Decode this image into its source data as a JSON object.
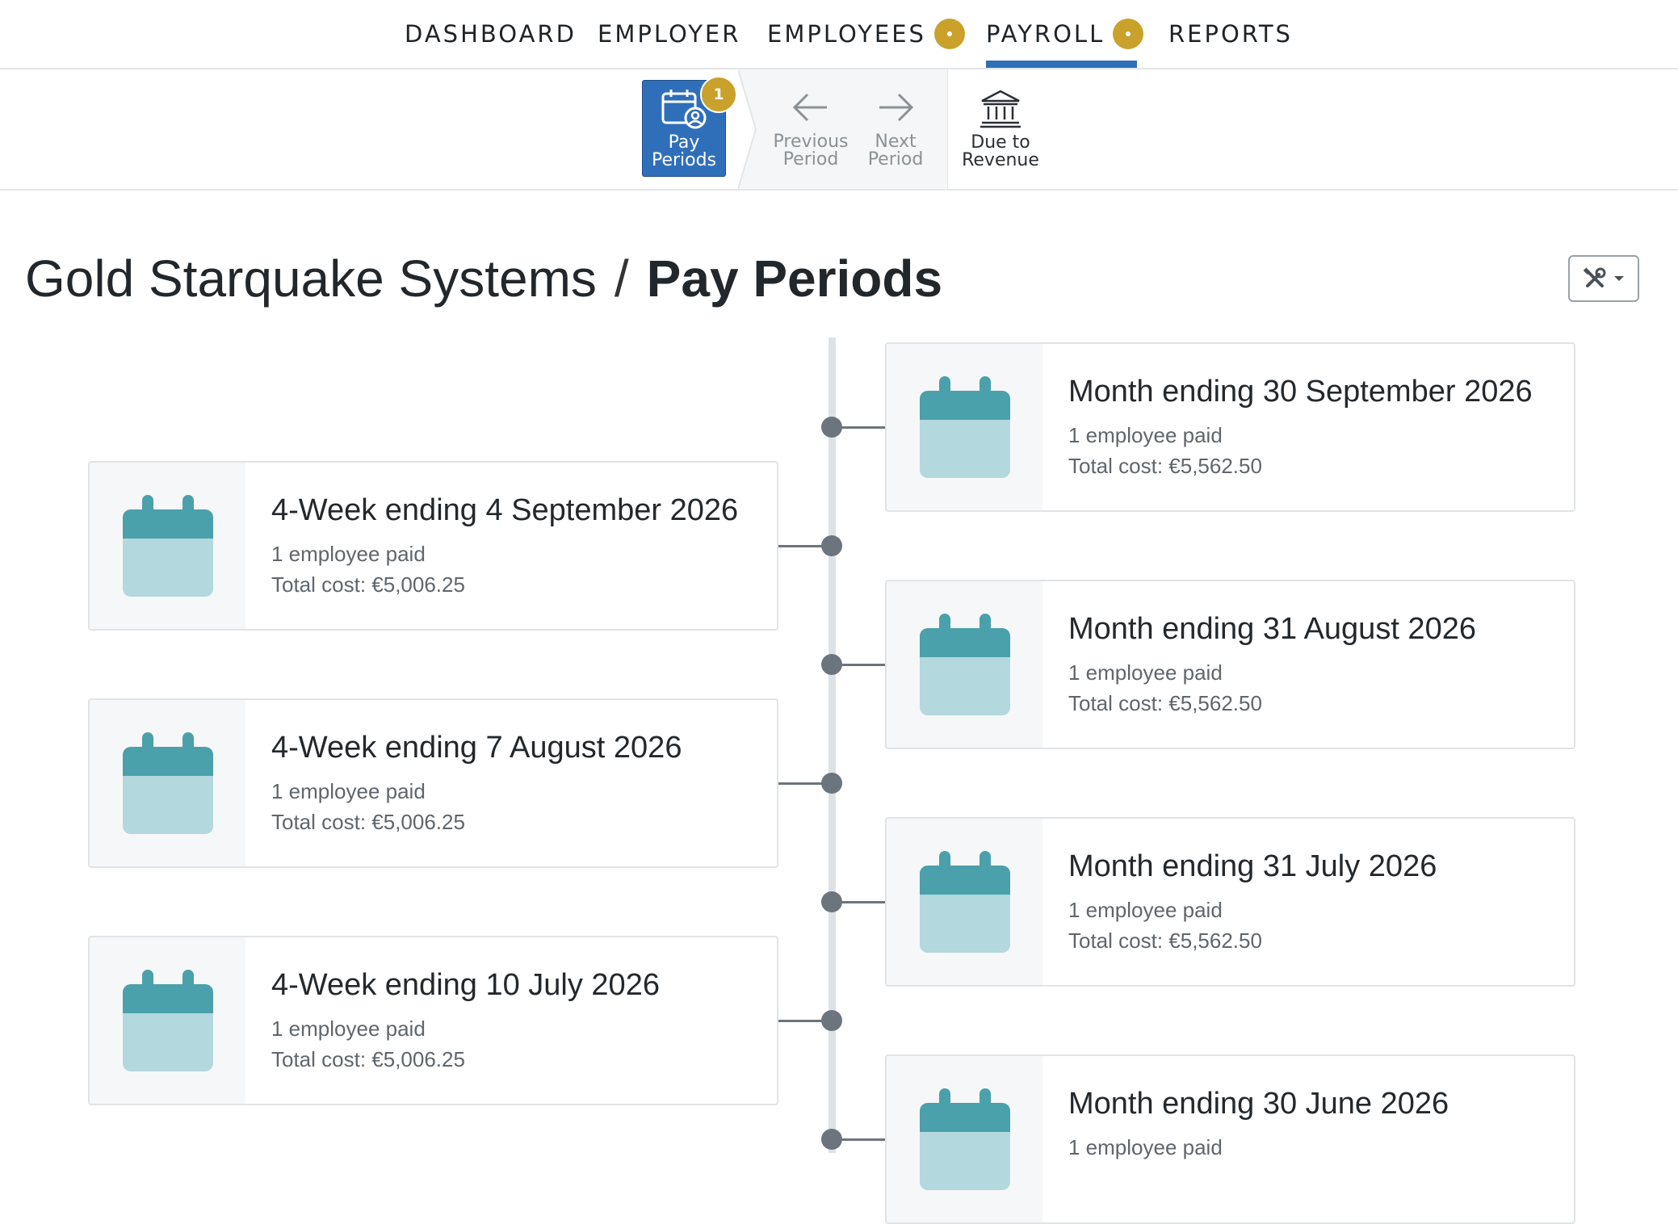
{
  "nav": {
    "items": [
      {
        "label": "DASHBOARD"
      },
      {
        "label": "EMPLOYER"
      },
      {
        "label": "EMPLOYEES"
      },
      {
        "label": "PAYROLL"
      },
      {
        "label": "REPORTS"
      }
    ],
    "active": "PAYROLL",
    "badge_color": "#c9a12b",
    "accent_color": "#2f6fba"
  },
  "toolbar": {
    "pay_periods": {
      "line1": "Pay",
      "line2": "Periods",
      "badge": "1",
      "icon": "calendar-user-icon"
    },
    "previous_period": {
      "line1": "Previous",
      "line2": "Period",
      "icon": "arrow-left-icon"
    },
    "next_period": {
      "line1": "Next",
      "line2": "Period",
      "icon": "arrow-right-icon"
    },
    "due_to_revenue": {
      "line1": "Due to",
      "line2": "Revenue",
      "icon": "bank-icon"
    }
  },
  "heading": {
    "company": "Gold Starquake Systems",
    "separator": "/",
    "page": "Pay Periods"
  },
  "settings_button": {
    "icon": "tools-icon"
  },
  "periods": [
    {
      "title": "Month ending 30 September 2026",
      "employees": "1 employee paid",
      "cost": "Total cost: €5,562.50",
      "side": "right"
    },
    {
      "title": "4-Week ending 4 September 2026",
      "employees": "1 employee paid",
      "cost": "Total cost: €5,006.25",
      "side": "left"
    },
    {
      "title": "Month ending 31 August 2026",
      "employees": "1 employee paid",
      "cost": "Total cost: €5,562.50",
      "side": "right"
    },
    {
      "title": "4-Week ending 7 August 2026",
      "employees": "1 employee paid",
      "cost": "Total cost: €5,006.25",
      "side": "left"
    },
    {
      "title": "Month ending 31 July 2026",
      "employees": "1 employee paid",
      "cost": "Total cost: €5,562.50",
      "side": "right"
    },
    {
      "title": "4-Week ending 10 July 2026",
      "employees": "1 employee paid",
      "cost": "Total cost: €5,006.25",
      "side": "left"
    },
    {
      "title": "Month ending 30 June 2026",
      "employees": "1 employee paid",
      "cost": "",
      "side": "right"
    }
  ],
  "calendar_icon_colors": {
    "header": "#4aa0ab",
    "body": "#b3d8de"
  }
}
